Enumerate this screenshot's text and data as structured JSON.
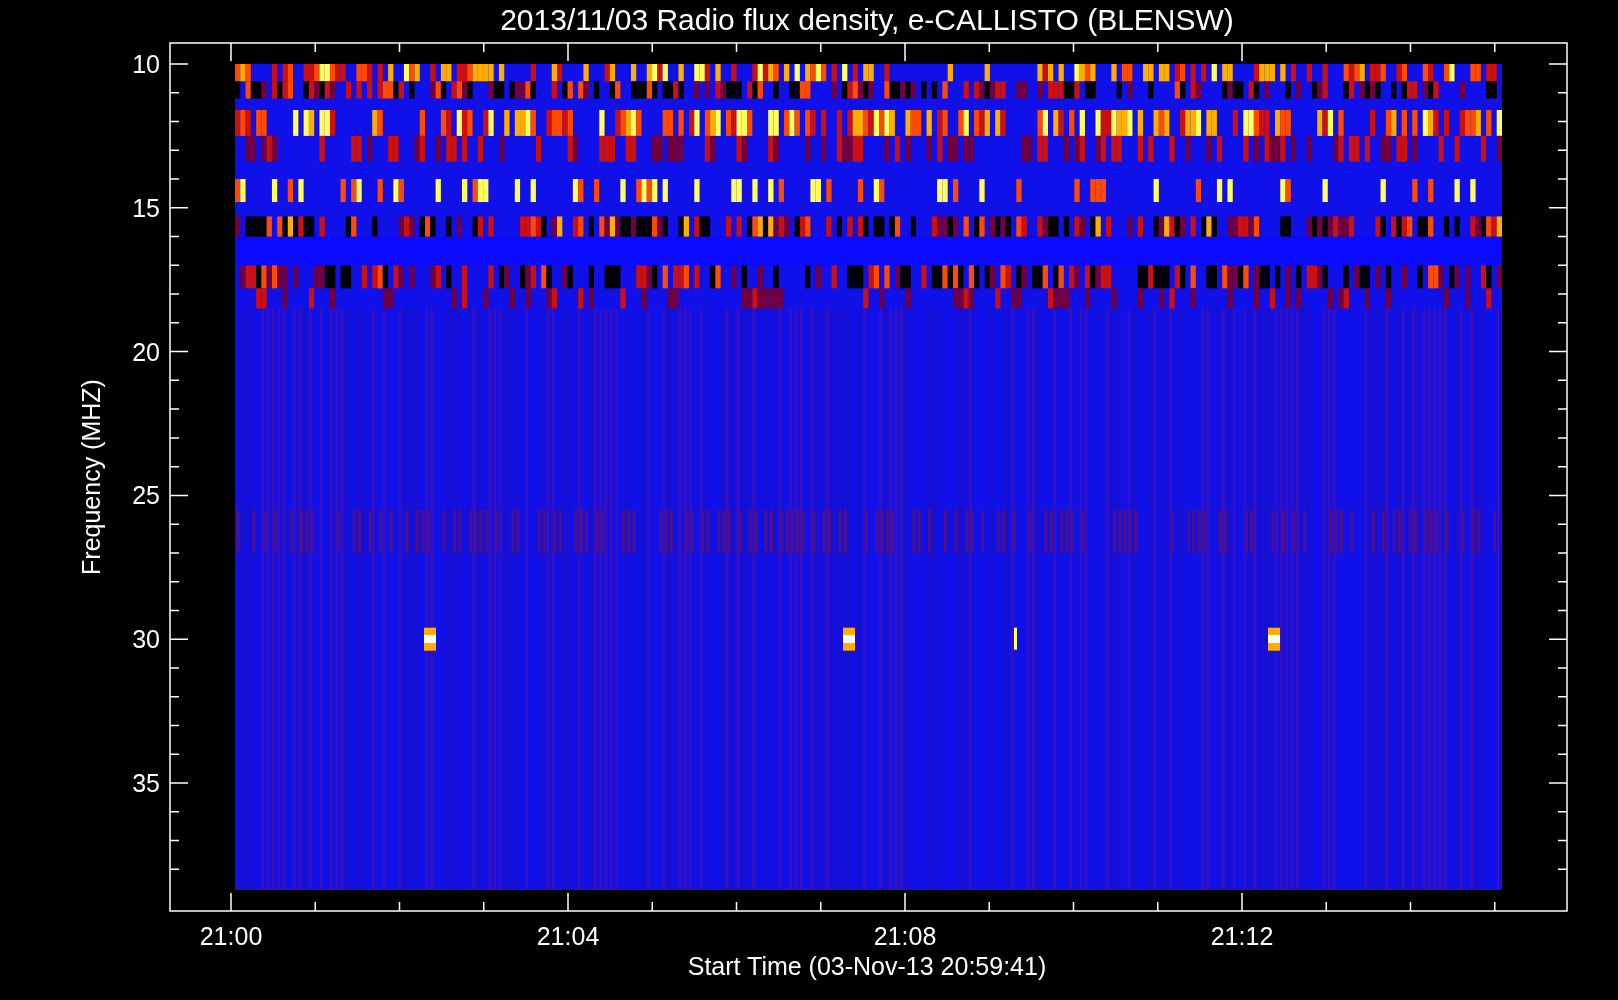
{
  "plot": {
    "title": "2013/11/03  Radio flux density, e-CALLISTO (BLENSW)",
    "ylabel": "Frequency (MHZ)",
    "xlabel": "Start Time (03-Nov-13 20:59:41)",
    "yticks": [
      "10",
      "15",
      "20",
      "25",
      "30",
      "35"
    ],
    "xticks": [
      "21:00",
      "21:04",
      "21:08",
      "21:12"
    ]
  }
}
